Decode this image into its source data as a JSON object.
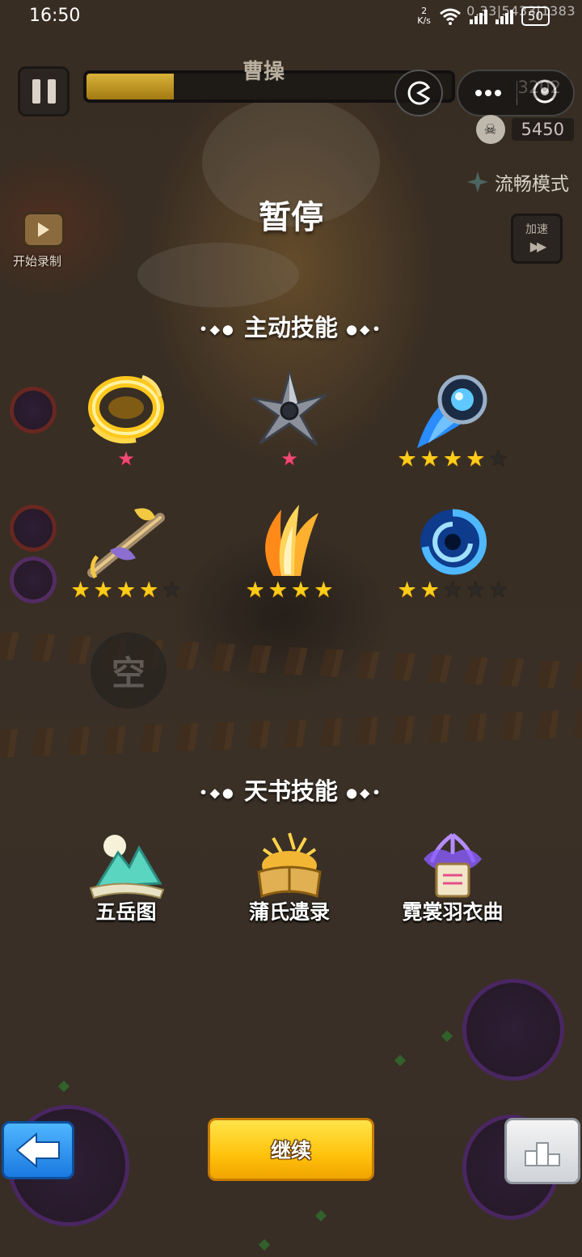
{
  "status_bar": {
    "time": "16:50",
    "net_speed_value": "2",
    "net_speed_unit": "K/s",
    "battery": "50",
    "coords_overlay": "0,33|5433|1383"
  },
  "hud": {
    "boss_name": "曹操",
    "boss_hp_fraction": 0.24,
    "stat_1": "3202",
    "stat_2": "5450",
    "smooth_mode": "流畅模式",
    "speed_label": "加速",
    "speed_arrows": "▶▶",
    "record_label": "开始录制",
    "empty_slot": "空"
  },
  "pause": {
    "title": "暂停",
    "active_skills_header": "主动技能",
    "book_skills_header": "天书技能",
    "header_deco_left": "•◆●",
    "header_deco_right": "●◆•"
  },
  "active_skills": [
    {
      "icon": "golden-ring-icon",
      "stars": 1,
      "max_stars": 1,
      "star_color": "red"
    },
    {
      "icon": "shuriken-icon",
      "stars": 1,
      "max_stars": 1,
      "star_color": "red"
    },
    {
      "icon": "blue-orb-comet-icon",
      "stars": 4,
      "max_stars": 5,
      "star_color": "gold"
    },
    {
      "icon": "golden-staff-icon",
      "stars": 4,
      "max_stars": 5,
      "star_color": "gold"
    },
    {
      "icon": "fire-feathers-icon",
      "stars": 4,
      "max_stars": 4,
      "star_color": "gold"
    },
    {
      "icon": "blue-vortex-icon",
      "stars": 2,
      "max_stars": 5,
      "star_color": "gold"
    }
  ],
  "book_skills": [
    {
      "name": "五岳图",
      "icon": "mountain-scroll-icon"
    },
    {
      "name": "蒲氏遗录",
      "icon": "golden-book-icon"
    },
    {
      "name": "霓裳羽衣曲",
      "icon": "purple-scroll-icon"
    }
  ],
  "controls": {
    "continue_label": "继续",
    "back_icon": "arrow-left-icon",
    "rank_icon": "podium-icon"
  },
  "colors": {
    "star_gold": "#ffcc1a",
    "star_red": "#ef4a73",
    "continue_yellow": "#ffc20c",
    "back_blue": "#1b79e0"
  }
}
